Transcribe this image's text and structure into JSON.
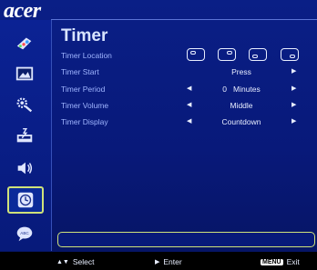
{
  "brand": {
    "logo_text": "acer"
  },
  "sidebar": {
    "items": [
      {
        "name": "color-settings",
        "icon": "palette-icon",
        "active": false
      },
      {
        "name": "image-settings",
        "icon": "picture-icon",
        "active": false
      },
      {
        "name": "management",
        "icon": "gear-tools-icon",
        "active": false
      },
      {
        "name": "management-2",
        "icon": "power-settings-icon",
        "active": false
      },
      {
        "name": "audio",
        "icon": "speaker-icon",
        "active": false
      },
      {
        "name": "timer",
        "icon": "clock-icon",
        "active": true
      },
      {
        "name": "language",
        "icon": "abc-bubble-icon",
        "active": false
      }
    ]
  },
  "menu": {
    "title": "Timer",
    "rows": [
      {
        "label": "Timer Location",
        "value": "",
        "has_arrows": false
      },
      {
        "label": "Timer Start",
        "value": "Press",
        "has_arrows": "right"
      },
      {
        "label": "Timer Period",
        "value": "0   Minutes",
        "has_arrows": "both"
      },
      {
        "label": "Timer Volume",
        "value": "Middle",
        "has_arrows": "both"
      },
      {
        "label": "Timer Display",
        "value": "Countdown",
        "has_arrows": "both"
      }
    ],
    "location_options": [
      "top-left",
      "top-right",
      "bottom-left",
      "bottom-right"
    ]
  },
  "footer": {
    "select_label": "Select",
    "enter_label": "Enter",
    "menu_key": "MENU",
    "exit_label": "Exit"
  },
  "colors": {
    "background": "#0a1f86",
    "highlight": "#cfe27a",
    "label": "#9fb5ff",
    "text": "#e8eeff"
  }
}
